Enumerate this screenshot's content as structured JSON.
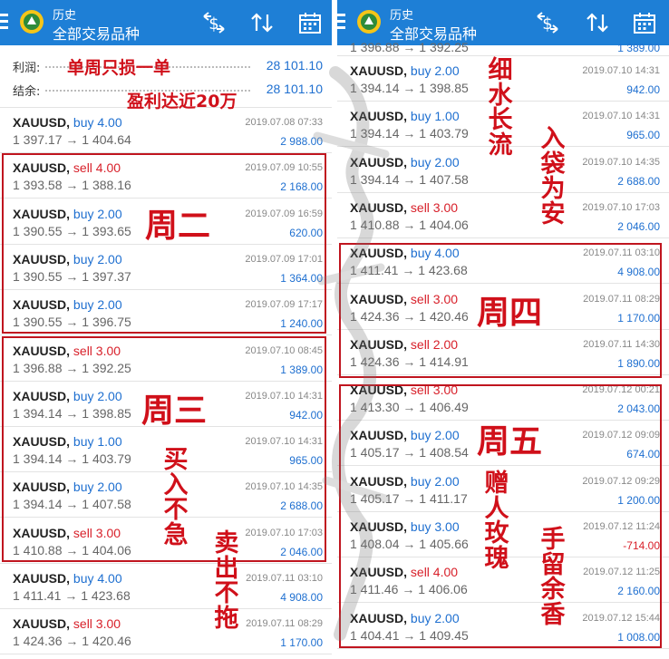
{
  "app": {
    "title": "历史",
    "subtitle": "全部交易品种"
  },
  "icons": [
    "menu-icon",
    "app-logo-icon",
    "currency-icon",
    "sort-icon",
    "calendar-icon"
  ],
  "colors": {
    "header": "#1e7fd6",
    "buy": "#1e6fd0",
    "sell": "#d8202a",
    "annotation": "#d0101a"
  },
  "left": {
    "summary": [
      {
        "label": "利润:",
        "value": "28 101.10"
      },
      {
        "label": "结余:",
        "value": "28 101.10"
      }
    ],
    "trades": [
      {
        "symbol": "XAUUSD,",
        "type": "buy 4.00",
        "prices": "1 397.17 → 1 404.64",
        "time": "2019.07.08 07:33",
        "profit": "2 988.00"
      },
      {
        "symbol": "XAUUSD,",
        "type": "sell 4.00",
        "prices": "1 393.58 → 1 388.16",
        "time": "2019.07.09 10:55",
        "profit": "2 168.00"
      },
      {
        "symbol": "XAUUSD,",
        "type": "buy 2.00",
        "prices": "1 390.55 → 1 393.65",
        "time": "2019.07.09 16:59",
        "profit": "620.00"
      },
      {
        "symbol": "XAUUSD,",
        "type": "buy 2.00",
        "prices": "1 390.55 → 1 397.37",
        "time": "2019.07.09 17:01",
        "profit": "1 364.00"
      },
      {
        "symbol": "XAUUSD,",
        "type": "buy 2.00",
        "prices": "1 390.55 → 1 396.75",
        "time": "2019.07.09 17:17",
        "profit": "1 240.00"
      },
      {
        "symbol": "XAUUSD,",
        "type": "sell 3.00",
        "prices": "1 396.88 → 1 392.25",
        "time": "2019.07.10 08:45",
        "profit": "1 389.00"
      },
      {
        "symbol": "XAUUSD,",
        "type": "buy 2.00",
        "prices": "1 394.14 → 1 398.85",
        "time": "2019.07.10 14:31",
        "profit": "942.00"
      },
      {
        "symbol": "XAUUSD,",
        "type": "buy 1.00",
        "prices": "1 394.14 → 1 403.79",
        "time": "2019.07.10 14:31",
        "profit": "965.00"
      },
      {
        "symbol": "XAUUSD,",
        "type": "buy 2.00",
        "prices": "1 394.14 → 1 407.58",
        "time": "2019.07.10 14:35",
        "profit": "2 688.00"
      },
      {
        "symbol": "XAUUSD,",
        "type": "sell 3.00",
        "prices": "1 410.88 → 1 404.06",
        "time": "2019.07.10 17:03",
        "profit": "2 046.00"
      },
      {
        "symbol": "XAUUSD,",
        "type": "buy 4.00",
        "prices": "1 411.41 → 1 423.68",
        "time": "2019.07.11 03:10",
        "profit": "4 908.00"
      },
      {
        "symbol": "XAUUSD,",
        "type": "sell 3.00",
        "prices": "1 424.36 → 1 420.46",
        "time": "2019.07.11 08:29",
        "profit": "1 170.00"
      }
    ],
    "annotations": {
      "a1": "单周只损一单",
      "a2": "盈利达近20万",
      "tue": "周二",
      "wed": "周三",
      "v1": "买入不急",
      "v2": "卖出不拖"
    }
  },
  "right": {
    "partial": {
      "prices": "1 396.88 → 1 392.25",
      "profit": "1 389.00"
    },
    "trades": [
      {
        "symbol": "XAUUSD,",
        "type": "buy 2.00",
        "prices": "1 394.14 → 1 398.85",
        "time": "2019.07.10 14:31",
        "profit": "942.00"
      },
      {
        "symbol": "XAUUSD,",
        "type": "buy 1.00",
        "prices": "1 394.14 → 1 403.79",
        "time": "2019.07.10 14:31",
        "profit": "965.00"
      },
      {
        "symbol": "XAUUSD,",
        "type": "buy 2.00",
        "prices": "1 394.14 → 1 407.58",
        "time": "2019.07.10 14:35",
        "profit": "2 688.00"
      },
      {
        "symbol": "XAUUSD,",
        "type": "sell 3.00",
        "prices": "1 410.88 → 1 404.06",
        "time": "2019.07.10 17:03",
        "profit": "2 046.00"
      },
      {
        "symbol": "XAUUSD,",
        "type": "buy 4.00",
        "prices": "1 411.41 → 1 423.68",
        "time": "2019.07.11 03:10",
        "profit": "4 908.00"
      },
      {
        "symbol": "XAUUSD,",
        "type": "sell 3.00",
        "prices": "1 424.36 → 1 420.46",
        "time": "2019.07.11 08:29",
        "profit": "1 170.00"
      },
      {
        "symbol": "XAUUSD,",
        "type": "sell 2.00",
        "prices": "1 424.36 → 1 414.91",
        "time": "2019.07.11 14:30",
        "profit": "1 890.00"
      },
      {
        "symbol": "XAUUSD,",
        "type": "sell 3.00",
        "prices": "1 413.30 → 1 406.49",
        "time": "2019.07.12 00:21",
        "profit": "2 043.00"
      },
      {
        "symbol": "XAUUSD,",
        "type": "buy 2.00",
        "prices": "1 405.17 → 1 408.54",
        "time": "2019.07.12 09:09",
        "profit": "674.00"
      },
      {
        "symbol": "XAUUSD,",
        "type": "buy 2.00",
        "prices": "1 405.17 → 1 411.17",
        "time": "2019.07.12 09:29",
        "profit": "1 200.00"
      },
      {
        "symbol": "XAUUSD,",
        "type": "buy 3.00",
        "prices": "1 408.04 → 1 405.66",
        "time": "2019.07.12 11:24",
        "profit": "-714.00"
      },
      {
        "symbol": "XAUUSD,",
        "type": "sell 4.00",
        "prices": "1 411.46 → 1 406.06",
        "time": "2019.07.12 11:25",
        "profit": "2 160.00"
      },
      {
        "symbol": "XAUUSD,",
        "type": "buy 2.00",
        "prices": "1 404.41 → 1 409.45",
        "time": "2019.07.12 15:44",
        "profit": "1 008.00"
      }
    ],
    "annotations": {
      "v1": "细水长流",
      "v2": "入袋为安",
      "thu": "周四",
      "fri": "周五",
      "v3": "赠人玫瑰",
      "v4": "手留余香"
    }
  }
}
